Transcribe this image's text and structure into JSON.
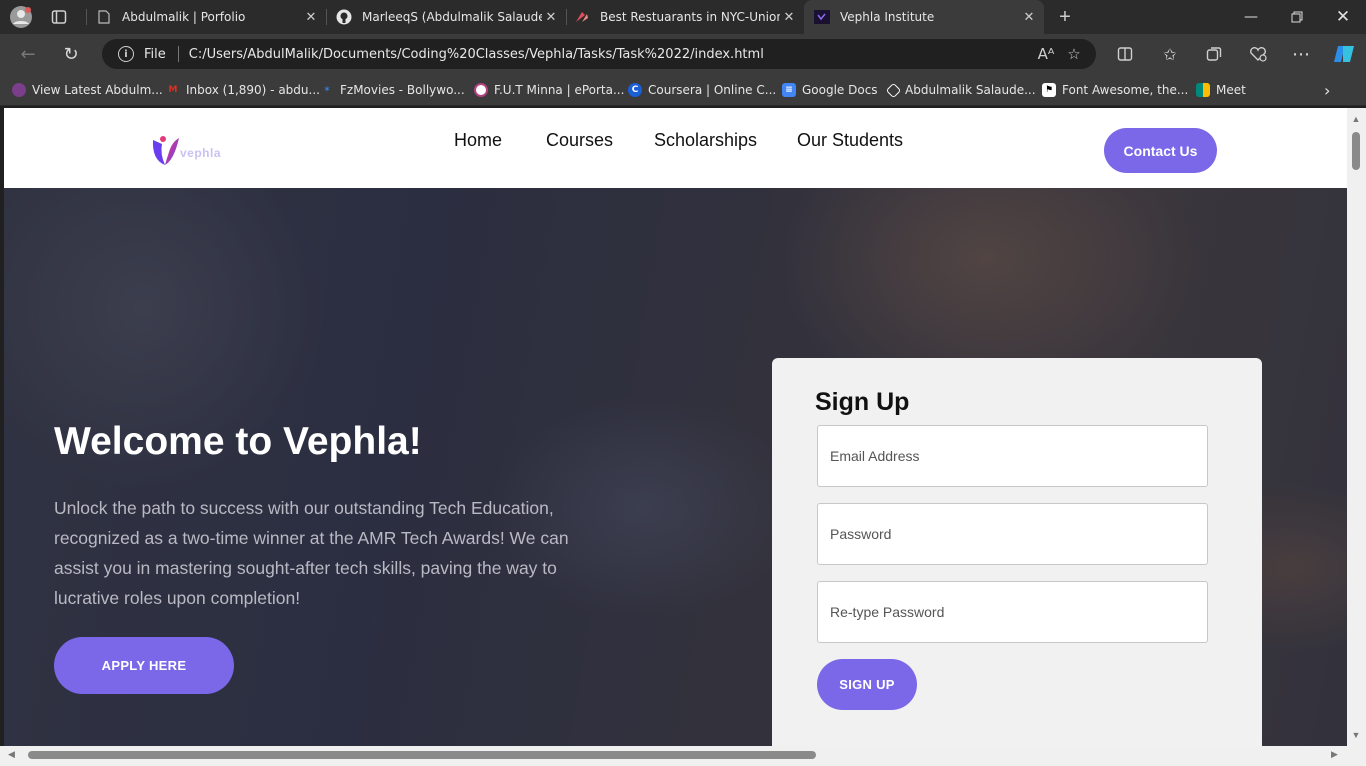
{
  "browser": {
    "tabs": [
      {
        "title": "Abdulmalik | Porfolio",
        "icon": "page-icon",
        "active": false
      },
      {
        "title": "MarleeqS (Abdulmalik Salaudeen",
        "icon": "github-icon",
        "active": false
      },
      {
        "title": "Best Restuarants in NYC-Union Sq",
        "icon": "restaurant-icon",
        "active": false
      },
      {
        "title": "Vephla Institute",
        "icon": "vephla-icon",
        "active": true
      }
    ],
    "address": {
      "scheme_label": "File",
      "url": "C:/Users/AbdulMalik/Documents/Coding%20Classes/Vephla/Tasks/Task%2022/index.html"
    },
    "bookmarks": [
      {
        "label": "View Latest Abdulm...",
        "icon": "fruit-icon",
        "color": "#7a3e8a"
      },
      {
        "label": "Inbox (1,890) - abdu...",
        "icon": "gmail-icon",
        "color": "#d93025"
      },
      {
        "label": "FzMovies - Bollywo...",
        "icon": "fz-icon",
        "color": "#3a7bd5"
      },
      {
        "label": "F.U.T Minna | ePorta...",
        "icon": "fut-icon",
        "color": "#b0417f"
      },
      {
        "label": "Coursera | Online C...",
        "icon": "coursera-icon",
        "color": "#1a5fd6"
      },
      {
        "label": "Google Docs",
        "icon": "docs-icon",
        "color": "#4285f4"
      },
      {
        "label": "Abdulmalik Salaude...",
        "icon": "codepen-icon",
        "color": "#ffffff"
      },
      {
        "label": "Font Awesome, the...",
        "icon": "flag-icon",
        "color": "#ffffff"
      },
      {
        "label": "Meet",
        "icon": "meet-icon",
        "color": "#00897b"
      }
    ]
  },
  "site": {
    "logo_text": "vephla",
    "nav": [
      "Home",
      "Courses",
      "Scholarships",
      "Our Students"
    ],
    "contact_label": "Contact Us",
    "accent": "#7b68e8"
  },
  "hero": {
    "title": "Welcome to Vephla!",
    "text": "Unlock the path to success with our outstanding Tech Education, recognized as a two-time winner at the AMR Tech Awards! We can assist you in mastering sought-after tech skills, paving the way to lucrative roles upon completion!",
    "apply_label": "APPLY HERE"
  },
  "signup": {
    "title": "Sign Up",
    "email_placeholder": "Email Address",
    "password_placeholder": "Password",
    "retype_placeholder": "Re-type Password",
    "button_label": "SIGN UP"
  }
}
